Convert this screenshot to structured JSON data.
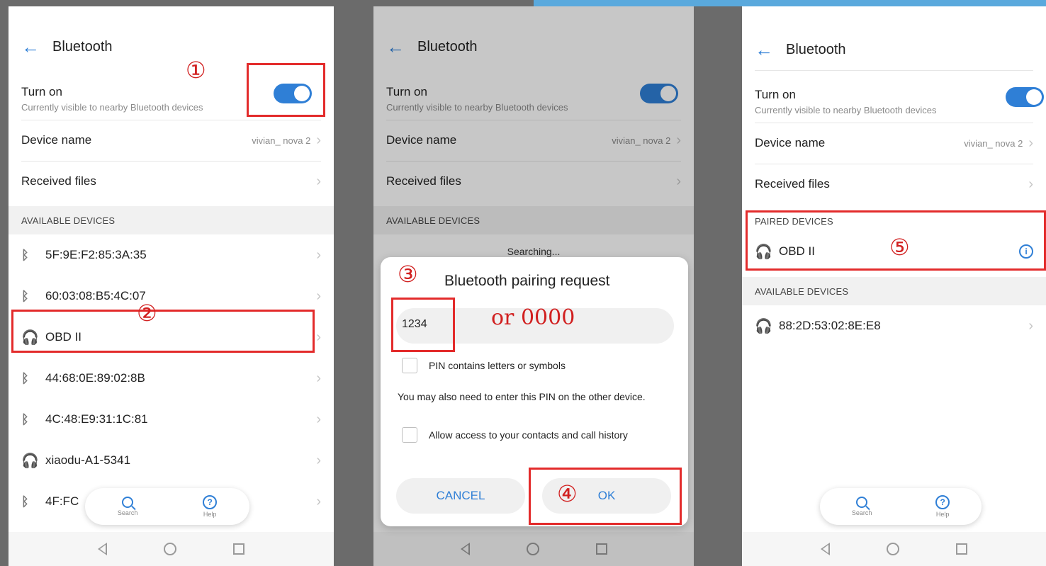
{
  "header": {
    "title": "Bluetooth"
  },
  "settings": {
    "turn_on_label": "Turn on",
    "turn_on_sub": "Currently visible to nearby Bluetooth devices",
    "device_name_label": "Device name",
    "device_name_value": "vivian_ nova 2",
    "received_files_label": "Received files",
    "toggle_state": "on"
  },
  "sections": {
    "available": "AVAILABLE DEVICES",
    "paired": "PAIRED DEVICES"
  },
  "panel1_devices": [
    {
      "name": "5F:9E:F2:85:3A:35",
      "icon": "bluetooth-icon"
    },
    {
      "name": "60:03:08:B5:4C:07",
      "icon": "bluetooth-icon"
    },
    {
      "name": "OBD II",
      "icon": "headset-icon"
    },
    {
      "name": "44:68:0E:89:02:8B",
      "icon": "bluetooth-icon"
    },
    {
      "name": "4C:48:E9:31:1C:81",
      "icon": "bluetooth-icon"
    },
    {
      "name": "xiaodu-A1-5341",
      "icon": "headset-icon"
    },
    {
      "name": "4F:FC",
      "icon": "bluetooth-icon"
    }
  ],
  "fab": {
    "search_label": "Search",
    "help_label": "Help"
  },
  "dialog": {
    "searching": "Searching...",
    "title": "Bluetooth pairing request",
    "pin_value": "1234",
    "alt_pin_note": "or 0000",
    "pin_letters_label": "PIN contains letters or symbols",
    "note": "You may also need to enter this PIN on the other device.",
    "contacts_label": "Allow access to your contacts and call history",
    "cancel_label": "CANCEL",
    "ok_label": "OK"
  },
  "panel3": {
    "paired_devices": [
      {
        "name": "OBD II",
        "icon": "headset-icon"
      }
    ],
    "available_devices": [
      {
        "name": "88:2D:53:02:8E:E8",
        "icon": "headset-icon"
      }
    ]
  },
  "annotations": {
    "step1": "①",
    "step2": "②",
    "step3": "③",
    "step4": "④",
    "step5": "⑤"
  },
  "colors": {
    "accent": "#2f7fd6",
    "highlight": "#e32b2b",
    "topbar": "#5aa9dd"
  }
}
